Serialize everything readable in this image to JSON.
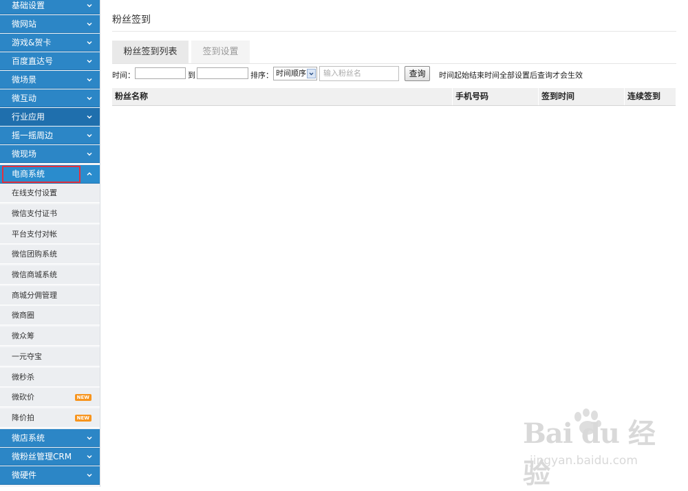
{
  "sidebar": {
    "categories_top": [
      {
        "label": "基础设置"
      },
      {
        "label": "微网站"
      },
      {
        "label": "游戏&贺卡"
      },
      {
        "label": "百度直达号"
      },
      {
        "label": "微场景"
      },
      {
        "label": "微互动"
      },
      {
        "label": "行业应用"
      },
      {
        "label": "摇一摇周边"
      },
      {
        "label": "微现场"
      }
    ],
    "expanded": {
      "label": "电商系统",
      "items": [
        {
          "label": "在线支付设置",
          "badge": ""
        },
        {
          "label": "微信支付证书",
          "badge": ""
        },
        {
          "label": "平台支付对帐",
          "badge": ""
        },
        {
          "label": "微信团购系统",
          "badge": ""
        },
        {
          "label": "微信商城系统",
          "badge": ""
        },
        {
          "label": "商城分佣管理",
          "badge": ""
        },
        {
          "label": "微商圈",
          "badge": ""
        },
        {
          "label": "微众筹",
          "badge": ""
        },
        {
          "label": "一元夺宝",
          "badge": ""
        },
        {
          "label": "微秒杀",
          "badge": ""
        },
        {
          "label": "微砍价",
          "badge": "NEW"
        },
        {
          "label": "降价拍",
          "badge": "NEW"
        }
      ]
    },
    "categories_bottom": [
      {
        "label": "微店系统"
      },
      {
        "label": "微粉丝管理CRM"
      },
      {
        "label": "微硬件"
      }
    ]
  },
  "main": {
    "title": "粉丝签到",
    "tabs": [
      {
        "label": "粉丝签到列表",
        "active": true
      },
      {
        "label": "签到设置",
        "active": false
      }
    ],
    "filter": {
      "time_label": "时间：",
      "to_label": "到",
      "sort_label": "排序：",
      "sort_value": "时间顺序",
      "fan_name_placeholder": "输入粉丝名",
      "query_label": "查询",
      "hint": "时间起始结束时间全部设置后查询才会生效"
    },
    "table": {
      "columns": [
        "粉丝名称",
        "手机号码",
        "签到时间",
        "连续签到"
      ],
      "rows": []
    }
  },
  "watermark": {
    "logo": "Bai du 经验",
    "url": "jingyan.baidu.com"
  },
  "colors": {
    "sidebar_category": "#2c86c6",
    "sidebar_highlight_border": "#e4303d",
    "badge_new": "#f7941d"
  }
}
